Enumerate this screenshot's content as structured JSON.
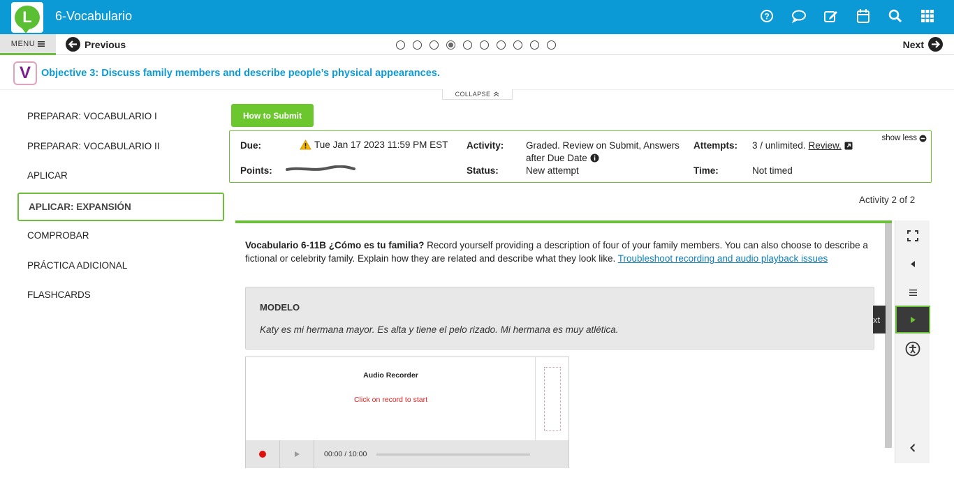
{
  "header": {
    "title": "6-Vocabulario",
    "logo_letter": "L",
    "icons": [
      "help-icon",
      "chat-icon",
      "edit-icon",
      "calendar-icon",
      "search-icon",
      "apps-grid-icon"
    ]
  },
  "nav": {
    "menu_label": "MENU",
    "previous_label": "Previous",
    "next_label": "Next",
    "page_dots": 10,
    "active_dot": 4
  },
  "objective": {
    "logo_letter": "V",
    "text": "Objective 3: Discuss family members and describe people’s physical appearances.",
    "collapse_label": "COLLAPSE"
  },
  "sidebar": {
    "items": [
      {
        "label": "PREPARAR: VOCABULARIO I",
        "active": false
      },
      {
        "label": "PREPARAR: VOCABULARIO II",
        "active": false
      },
      {
        "label": "APLICAR",
        "active": false
      },
      {
        "label": "APLICAR: EXPANSIÓN",
        "active": true
      },
      {
        "label": "COMPROBAR",
        "active": false
      },
      {
        "label": "PRÁCTICA ADICIONAL",
        "active": false
      },
      {
        "label": "FLASHCARDS",
        "active": false
      }
    ]
  },
  "how_to_submit_label": "How to Submit",
  "info": {
    "due_label": "Due:",
    "due_value": "Tue Jan 17 2023 11:59 PM EST",
    "points_label": "Points:",
    "activity_label": "Activity:",
    "activity_value_line1": "Graded. Review on Submit, Answers",
    "activity_value_line2": "after Due Date",
    "status_label": "Status:",
    "status_value": "New attempt",
    "attempts_label": "Attempts:",
    "attempts_value": "3 / unlimited.",
    "review_link": "Review.",
    "time_label": "Time:",
    "time_value": "Not timed",
    "show_less_label": "show less"
  },
  "activity_count": "Activity 2 of 2",
  "content": {
    "title": "Vocabulario 6-11B ¿Cómo es tu familia?",
    "instructions": " Record yourself providing a description of four of your family members. You can also choose to describe a fictional or celebrity family. Explain how they are related and describe what they look like. ",
    "link": "Troubleshoot recording and audio playback issues",
    "modelo_title": "MODELO",
    "modelo_text": "Katy es mi hermana mayor. Es alta y tiene el pelo rizado. Mi hermana es muy atlética."
  },
  "recorder": {
    "title": "Audio Recorder",
    "message": "Click on record to start",
    "time": "00:00 / 10:00"
  },
  "hidden_tab_text": "xt",
  "colors": {
    "header_blue": "#0c9ad6",
    "accent_green": "#6cbf3a",
    "record_red": "#e01010"
  }
}
